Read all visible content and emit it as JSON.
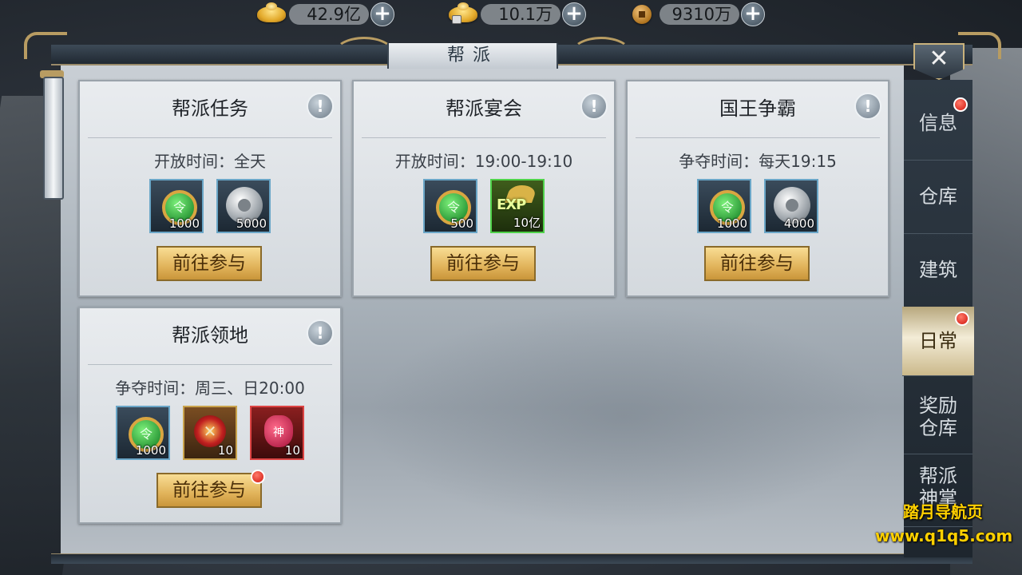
{
  "currencies": [
    {
      "icon": "gold-ingot-icon",
      "value": "42.9亿"
    },
    {
      "icon": "bound-ingot-icon",
      "value": "10.1万"
    },
    {
      "icon": "copper-coin-icon",
      "value": "9310万"
    }
  ],
  "window": {
    "title": "帮派"
  },
  "tabs": [
    {
      "label": "信息",
      "badge": true
    },
    {
      "label": "仓库",
      "badge": false
    },
    {
      "label": "建筑",
      "badge": false
    },
    {
      "label": "日常",
      "badge": true,
      "active": true
    },
    {
      "label": "奖励\n仓库",
      "badge": false
    },
    {
      "label": "帮派\n神掌",
      "badge": false
    }
  ],
  "cards": [
    {
      "title": "帮派任务",
      "time": "开放时间：全天",
      "rewards": [
        {
          "icon": "jade-token-icon",
          "count": "1000"
        },
        {
          "icon": "silver-coin-icon",
          "count": "5000"
        }
      ],
      "button": "前往参与",
      "button_badge": false
    },
    {
      "title": "帮派宴会",
      "time": "开放时间：19:00-19:10",
      "rewards": [
        {
          "icon": "jade-token-icon",
          "count": "500"
        },
        {
          "icon": "exp-icon",
          "count": "10亿"
        }
      ],
      "button": "前往参与",
      "button_badge": false
    },
    {
      "title": "国王争霸",
      "time": "争夺时间：每天19:15",
      "rewards": [
        {
          "icon": "jade-token-icon",
          "count": "1000"
        },
        {
          "icon": "silver-coin-icon",
          "count": "4000"
        }
      ],
      "button": "前往参与",
      "button_badge": false
    },
    {
      "title": "帮派领地",
      "time": "争夺时间：周三、日20:00",
      "rewards": [
        {
          "icon": "jade-token-icon",
          "count": "1000"
        },
        {
          "icon": "crossed-swords-emblem-icon",
          "count": "10"
        },
        {
          "icon": "god-bag-icon",
          "count": "10"
        }
      ],
      "button": "前往参与",
      "button_badge": true
    }
  ],
  "icon_text": {
    "jade": "令",
    "exp": "EXP",
    "bag": "神",
    "close": "✕",
    "info": "!"
  },
  "watermark": {
    "line1": "踏月导航页",
    "line2": "www.q1q5.com"
  },
  "colors": {
    "badge": "#d0160d",
    "button": "#e1b35a",
    "active_tab": "#f3ecd7"
  }
}
